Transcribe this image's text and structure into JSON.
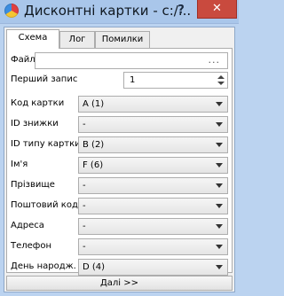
{
  "window": {
    "title": "Дисконтні картки - c:/...",
    "help_label": "?",
    "close_label": "✕",
    "icon": "app-icon"
  },
  "tabs": [
    {
      "label": "Схема",
      "active": true
    },
    {
      "label": "Лог",
      "active": false
    },
    {
      "label": "Помилки",
      "active": false
    }
  ],
  "file": {
    "label": "Файл",
    "value": "",
    "browse_label": "..."
  },
  "first_record": {
    "label": "Перший запис",
    "value": "1"
  },
  "fields": [
    {
      "label": "Код картки",
      "value": "A (1)"
    },
    {
      "label": "ID знижки",
      "value": "-"
    },
    {
      "label": "ID типу картки",
      "value": "B (2)"
    },
    {
      "label": "Ім'я",
      "value": "F (6)"
    },
    {
      "label": "Прізвище",
      "value": "-"
    },
    {
      "label": "Поштовий код",
      "value": "-"
    },
    {
      "label": "Адреса",
      "value": "-"
    },
    {
      "label": "Телефон",
      "value": "-"
    },
    {
      "label": "День народж.",
      "value": "D (4)"
    }
  ],
  "next_button": {
    "label": "Далі >>"
  }
}
